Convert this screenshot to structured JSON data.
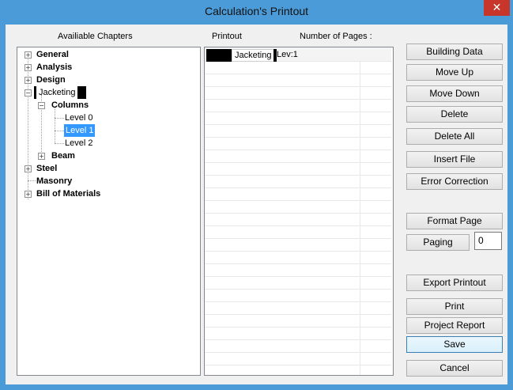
{
  "window": {
    "title": "Calculation's Printout",
    "close_glyph": "✕"
  },
  "labels": {
    "available": "Availiable Chapters",
    "printout": "Printout",
    "num_pages": "Number of Pages :"
  },
  "tree": {
    "general": "General",
    "analysis": "Analysis",
    "design": "Design",
    "jacketing": "Jacketing",
    "columns": "Columns",
    "level0": "Level 0",
    "level1": "Level 1",
    "level2": "Level 2",
    "beam": "Beam",
    "steel": "Steel",
    "masonry": "Masonry",
    "bom": "Bill of Materials"
  },
  "printout_rows": [
    {
      "chapter": "Jacketing",
      "level": "Lev:1"
    }
  ],
  "buttons": {
    "building_data": "Building Data",
    "move_up": "Move Up",
    "move_down": "Move Down",
    "delete": "Delete",
    "delete_all": "Delete All",
    "insert_file": "Insert File",
    "error_correction": "Error Correction",
    "format_page": "Format Page",
    "paging": "Paging",
    "export_printout": "Export Printout",
    "print": "Print",
    "project_report": "Project Report",
    "save": "Save",
    "cancel": "Cancel"
  },
  "paging_value": "0",
  "colors": {
    "frame": "#4a9bd7",
    "selection": "#3399ff",
    "close": "#c7352b"
  }
}
